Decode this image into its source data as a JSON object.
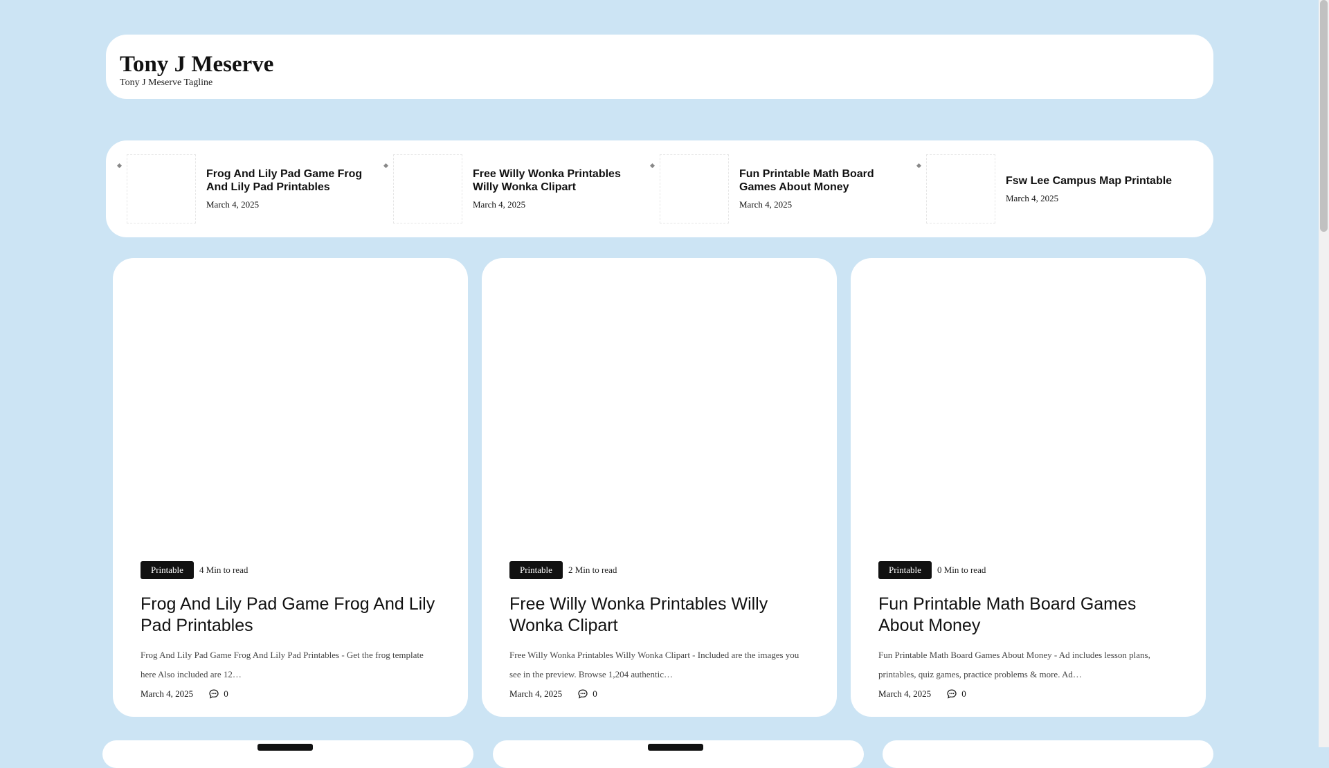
{
  "site": {
    "title": "Tony J Meserve",
    "tagline": "Tony J Meserve Tagline"
  },
  "trending": [
    {
      "title": "Frog And Lily Pad Game Frog And Lily Pad Printables",
      "date": "March 4, 2025"
    },
    {
      "title": "Free Willy Wonka Printables Willy Wonka Clipart",
      "date": "March 4, 2025"
    },
    {
      "title": "Fun Printable Math Board Games About Money",
      "date": "March 4, 2025"
    },
    {
      "title": "Fsw Lee Campus Map Printable",
      "date": "March 4, 2025"
    }
  ],
  "posts": [
    {
      "category": "Printable",
      "read_time": "4 Min to read",
      "title": "Frog And Lily Pad Game Frog And Lily Pad Printables",
      "excerpt": "Frog And Lily Pad Game Frog And Lily Pad Printables - Get the frog template here Also included are 12…",
      "date": "March 4, 2025",
      "comments": "0"
    },
    {
      "category": "Printable",
      "read_time": "2 Min to read",
      "title": "Free Willy Wonka Printables Willy Wonka Clipart",
      "excerpt": "Free Willy Wonka Printables Willy Wonka Clipart - Included are the images you see in the preview. Browse 1,204 authentic…",
      "date": "March 4, 2025",
      "comments": "0"
    },
    {
      "category": "Printable",
      "read_time": "0 Min to read",
      "title": "Fun Printable Math Board Games About Money",
      "excerpt": "Fun Printable Math Board Games About Money - Ad includes lesson plans, printables, quiz games, practice problems & more. Ad…",
      "date": "March 4, 2025",
      "comments": "0"
    }
  ],
  "icons": {
    "comment": "comment-icon"
  },
  "colors": {
    "background": "#cce4f4",
    "card": "#ffffff",
    "badge": "#111111"
  }
}
